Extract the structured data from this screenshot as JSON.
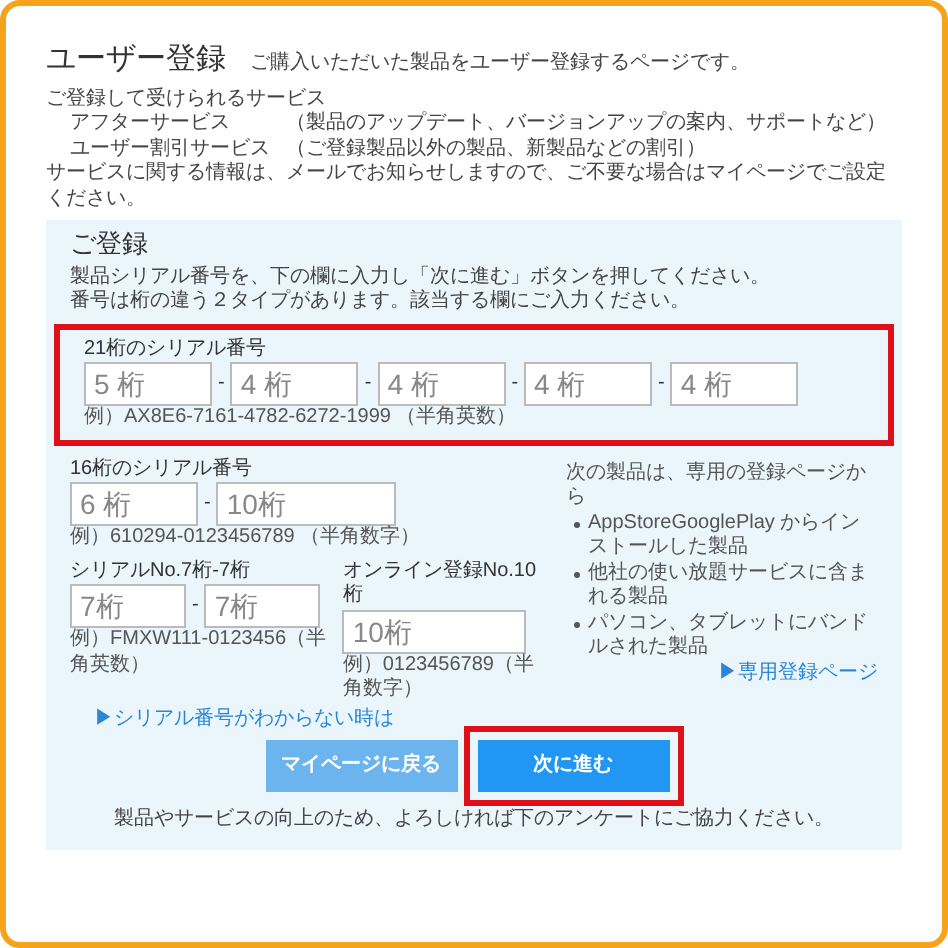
{
  "header": {
    "title": "ユーザー登録",
    "subtitle": "ご購入いただいた製品をユーザー登録するページです。"
  },
  "services": {
    "heading": "ご登録して受けられるサービス",
    "items": [
      {
        "name": "アフターサービス",
        "description": "（製品のアップデート、バージョンアップの案内、サポートなど）"
      },
      {
        "name": "ユーザー割引サービス",
        "description": "（ご登録製品以外の製品、新製品などの割引）"
      }
    ],
    "note": "サービスに関する情報は、メールでお知らせしますので、ご不要な場合はマイページでご設定ください。"
  },
  "form": {
    "title": "ご登録",
    "instructions": [
      "製品シリアル番号を、下の欄に入力し「次に進む」ボタンを押してください。",
      "番号は桁の違う２タイプがあります。該当する欄にご入力ください。"
    ],
    "serial_21": {
      "label": "21桁のシリアル番号",
      "highlighted": true,
      "separator": "-",
      "fields": [
        {
          "placeholder": "5 桁"
        },
        {
          "placeholder": "4 桁"
        },
        {
          "placeholder": "4 桁"
        },
        {
          "placeholder": "4 桁"
        },
        {
          "placeholder": "4 桁"
        }
      ],
      "example": "例）AX8E6-7161-4782-6272-1999 （半角英数）"
    },
    "serial_16": {
      "label": "16桁のシリアル番号",
      "separator": "-",
      "fields": [
        {
          "placeholder": "6 桁"
        },
        {
          "placeholder": "10桁"
        }
      ],
      "example": "例）610294-0123456789 （半角数字）"
    },
    "serial_7_7": {
      "label": "シリアルNo.7桁-7桁",
      "separator": "-",
      "fields": [
        {
          "placeholder": "7桁"
        },
        {
          "placeholder": "7桁"
        }
      ],
      "example": "例）FMXW111-0123456（半角英数）"
    },
    "online_10": {
      "label": "オンライン登録No.10桁",
      "fields": [
        {
          "placeholder": "10桁"
        }
      ],
      "example": "例）0123456789（半角数字）"
    },
    "other_products": {
      "heading": "次の製品は、専用の登録ページから",
      "items": [
        "AppStoreGooglePlay からインストールした製品",
        "他社の使い放題サービスに含まれる製品",
        "パソコン、タブレットにバンドルされた製品"
      ],
      "link": "▶専用登録ページ"
    },
    "help_link": "▶シリアル番号がわからない時は",
    "buttons": [
      {
        "label": "マイページに戻る",
        "kind": "secondary",
        "highlighted": false
      },
      {
        "label": "次に進む",
        "kind": "primary",
        "highlighted": true
      }
    ],
    "footer_note": "製品やサービスの向上のため、よろしければ下のアンケートにご協力ください。"
  }
}
